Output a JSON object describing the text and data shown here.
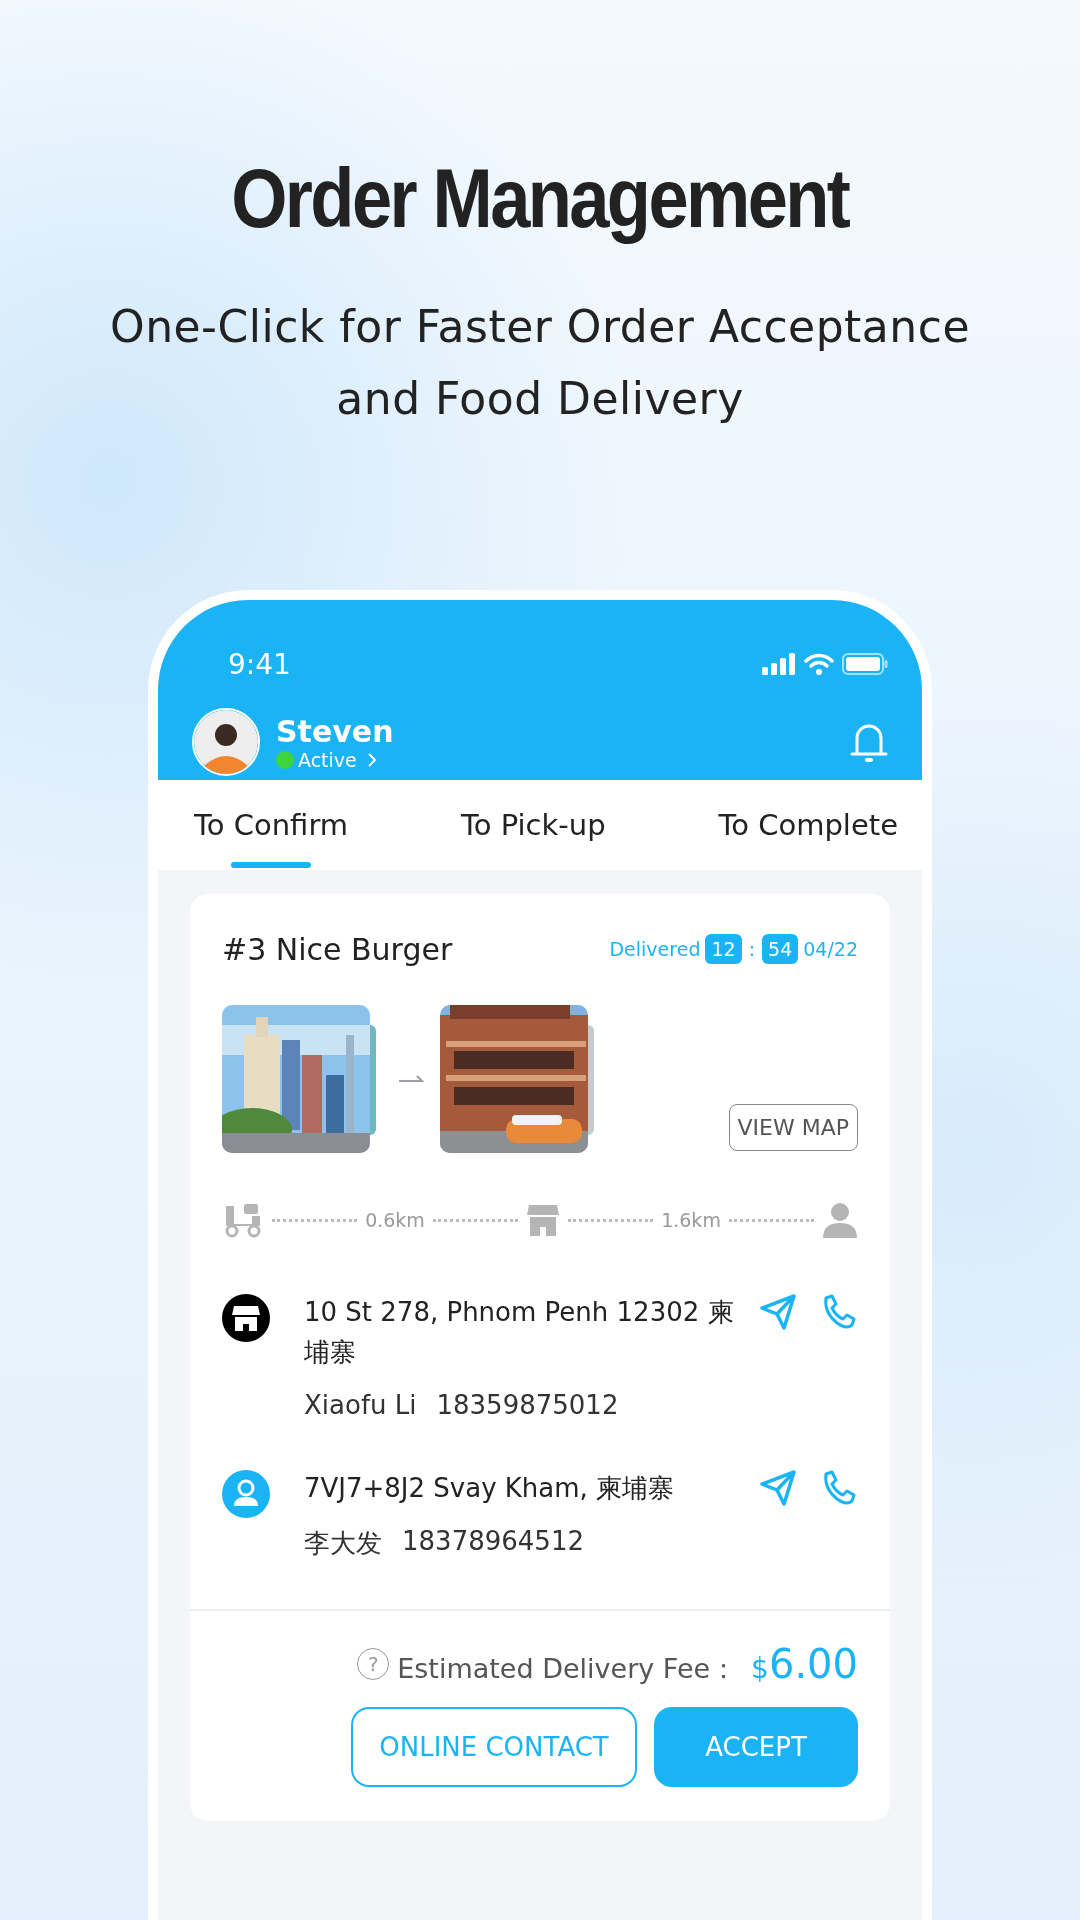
{
  "headline": {
    "title": "Order Management",
    "subtitle": [
      "One-Click for Faster Order Acceptance",
      "and Food Delivery"
    ]
  },
  "status_bar": {
    "time": "9:41"
  },
  "profile": {
    "name": "Steven",
    "status": "Active",
    "online": true
  },
  "tabs": [
    {
      "label": "To Confirm",
      "selected": true
    },
    {
      "label": "To Pick-up",
      "selected": false
    },
    {
      "label": "To Complete",
      "selected": false
    }
  ],
  "order": {
    "title": "#3 Nice Burger",
    "status": "Delivered",
    "hour": "12",
    "separator": ":",
    "minute": "54",
    "date": "04/22",
    "view_map": "VIEW MAP",
    "distances": [
      "0.6km",
      "1.6km"
    ],
    "stops": [
      {
        "kind": "store",
        "address": "10 St 278, Phnom Penh 12302 柬埔寨",
        "name": "Xiaofu Li",
        "phone": "18359875012"
      },
      {
        "kind": "customer",
        "address": "7VJ7+8J2 Svay Kham, 柬埔寨",
        "name": "李大发",
        "phone": "18378964512"
      }
    ],
    "fee": {
      "help": "?",
      "label": "Estimated Delivery Fee：",
      "currency": "$",
      "amount": "6.00"
    },
    "buttons": [
      {
        "kind": "outline",
        "label": "ONLINE CONTACT"
      },
      {
        "kind": "primary",
        "label": "ACCEPT"
      }
    ]
  }
}
